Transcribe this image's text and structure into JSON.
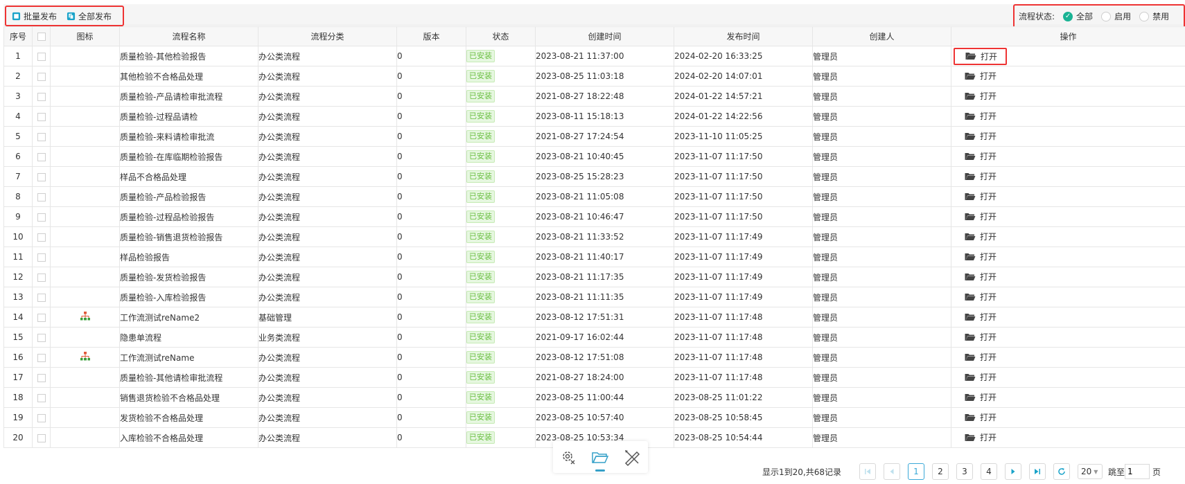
{
  "toolbar": {
    "batch_publish": "批量发布",
    "publish_all": "全部发布",
    "status_label": "流程状态:",
    "status_options": [
      "全部",
      "启用",
      "禁用"
    ],
    "status_selected": "全部"
  },
  "table": {
    "headers": {
      "seq": "序号",
      "icon": "图标",
      "name": "流程名称",
      "category": "流程分类",
      "version": "版本",
      "status": "状态",
      "created": "创建时间",
      "published": "发布时间",
      "creator": "创建人",
      "action": "操作"
    },
    "rows": [
      {
        "seq": "1",
        "icon": "",
        "name": "质量检验-其他检验报告",
        "category": "办公类流程",
        "version": "0",
        "status": "已安装",
        "created": "2023-08-21 11:37:00",
        "published": "2024-02-20 16:33:25",
        "creator": "管理员",
        "action": "打开"
      },
      {
        "seq": "2",
        "icon": "",
        "name": "其他检验不合格品处理",
        "category": "办公类流程",
        "version": "0",
        "status": "已安装",
        "created": "2023-08-25 11:03:18",
        "published": "2024-02-20 14:07:01",
        "creator": "管理员",
        "action": "打开"
      },
      {
        "seq": "3",
        "icon": "",
        "name": "质量检验-产品请检审批流程",
        "category": "办公类流程",
        "version": "0",
        "status": "已安装",
        "created": "2021-08-27 18:22:48",
        "published": "2024-01-22 14:57:21",
        "creator": "管理员",
        "action": "打开"
      },
      {
        "seq": "4",
        "icon": "",
        "name": "质量检验-过程品请检",
        "category": "办公类流程",
        "version": "0",
        "status": "已安装",
        "created": "2023-08-11 15:18:13",
        "published": "2024-01-22 14:22:56",
        "creator": "管理员",
        "action": "打开"
      },
      {
        "seq": "5",
        "icon": "",
        "name": "质量检验-来料请检审批流",
        "category": "办公类流程",
        "version": "0",
        "status": "已安装",
        "created": "2021-08-27 17:24:54",
        "published": "2023-11-10 11:05:25",
        "creator": "管理员",
        "action": "打开"
      },
      {
        "seq": "6",
        "icon": "",
        "name": "质量检验-在库临期检验报告",
        "category": "办公类流程",
        "version": "0",
        "status": "已安装",
        "created": "2023-08-21 10:40:45",
        "published": "2023-11-07 11:17:50",
        "creator": "管理员",
        "action": "打开"
      },
      {
        "seq": "7",
        "icon": "",
        "name": "样品不合格品处理",
        "category": "办公类流程",
        "version": "0",
        "status": "已安装",
        "created": "2023-08-25 15:28:23",
        "published": "2023-11-07 11:17:50",
        "creator": "管理员",
        "action": "打开"
      },
      {
        "seq": "8",
        "icon": "",
        "name": "质量检验-产品检验报告",
        "category": "办公类流程",
        "version": "0",
        "status": "已安装",
        "created": "2023-08-21 11:05:08",
        "published": "2023-11-07 11:17:50",
        "creator": "管理员",
        "action": "打开"
      },
      {
        "seq": "9",
        "icon": "",
        "name": "质量检验-过程品检验报告",
        "category": "办公类流程",
        "version": "0",
        "status": "已安装",
        "created": "2023-08-21 10:46:47",
        "published": "2023-11-07 11:17:50",
        "creator": "管理员",
        "action": "打开"
      },
      {
        "seq": "10",
        "icon": "",
        "name": "质量检验-销售退货检验报告",
        "category": "办公类流程",
        "version": "0",
        "status": "已安装",
        "created": "2023-08-21 11:33:52",
        "published": "2023-11-07 11:17:49",
        "creator": "管理员",
        "action": "打开"
      },
      {
        "seq": "11",
        "icon": "",
        "name": "样品检验报告",
        "category": "办公类流程",
        "version": "0",
        "status": "已安装",
        "created": "2023-08-21 11:40:17",
        "published": "2023-11-07 11:17:49",
        "creator": "管理员",
        "action": "打开"
      },
      {
        "seq": "12",
        "icon": "",
        "name": "质量检验-发货检验报告",
        "category": "办公类流程",
        "version": "0",
        "status": "已安装",
        "created": "2023-08-21 11:17:35",
        "published": "2023-11-07 11:17:49",
        "creator": "管理员",
        "action": "打开"
      },
      {
        "seq": "13",
        "icon": "",
        "name": "质量检验-入库检验报告",
        "category": "办公类流程",
        "version": "0",
        "status": "已安装",
        "created": "2023-08-21 11:11:35",
        "published": "2023-11-07 11:17:49",
        "creator": "管理员",
        "action": "打开"
      },
      {
        "seq": "14",
        "icon": "org-chart-icon",
        "name": "工作流测试reName2",
        "category": "基础管理",
        "version": "0",
        "status": "已安装",
        "created": "2023-08-12 17:51:31",
        "published": "2023-11-07 11:17:48",
        "creator": "管理员",
        "action": "打开"
      },
      {
        "seq": "15",
        "icon": "",
        "name": "隐患单流程",
        "category": "业务类流程",
        "version": "0",
        "status": "已安装",
        "created": "2021-09-17 16:02:44",
        "published": "2023-11-07 11:17:48",
        "creator": "管理员",
        "action": "打开"
      },
      {
        "seq": "16",
        "icon": "org-chart-icon",
        "name": "工作流测试reName",
        "category": "办公类流程",
        "version": "0",
        "status": "已安装",
        "created": "2023-08-12 17:51:08",
        "published": "2023-11-07 11:17:48",
        "creator": "管理员",
        "action": "打开"
      },
      {
        "seq": "17",
        "icon": "",
        "name": "质量检验-其他请检审批流程",
        "category": "办公类流程",
        "version": "0",
        "status": "已安装",
        "created": "2021-08-27 18:24:00",
        "published": "2023-11-07 11:17:48",
        "creator": "管理员",
        "action": "打开"
      },
      {
        "seq": "18",
        "icon": "",
        "name": "销售退货检验不合格品处理",
        "category": "办公类流程",
        "version": "0",
        "status": "已安装",
        "created": "2023-08-25 11:00:44",
        "published": "2023-08-25 11:01:22",
        "creator": "管理员",
        "action": "打开"
      },
      {
        "seq": "19",
        "icon": "",
        "name": "发货检验不合格品处理",
        "category": "办公类流程",
        "version": "0",
        "status": "已安装",
        "created": "2023-08-25 10:57:40",
        "published": "2023-08-25 10:58:45",
        "creator": "管理员",
        "action": "打开"
      },
      {
        "seq": "20",
        "icon": "",
        "name": "入库检验不合格品处理",
        "category": "办公类流程",
        "version": "0",
        "status": "已安装",
        "created": "2023-08-25 10:53:34",
        "published": "2023-08-25 10:54:44",
        "creator": "管理员",
        "action": "打开"
      }
    ]
  },
  "floatbar": {
    "icons": [
      "settings-gear-icon",
      "folder-open-icon",
      "design-tools-icon"
    ],
    "active": "folder-open-icon"
  },
  "pager": {
    "info": "显示1到20,共68记录",
    "pages": [
      "1",
      "2",
      "3",
      "4"
    ],
    "current_page": "1",
    "page_size": "20",
    "jump_label": "跳至",
    "jump_value": "1",
    "page_suffix": "页"
  },
  "colors": {
    "highlight_border": "#ee3333",
    "status_badge_bg": "#e6f7e0",
    "status_badge_text": "#6cc043",
    "accent": "#1ab394",
    "pager_active": "#3aa8d8"
  }
}
